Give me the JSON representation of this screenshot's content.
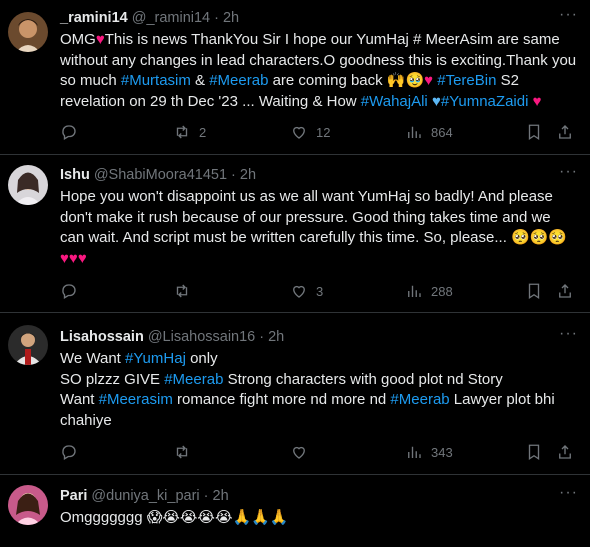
{
  "tweets": [
    {
      "name": "_ramini14",
      "handle": "@_ramini14",
      "time": "2h",
      "text_parts": [
        {
          "t": "OMG"
        },
        {
          "t": "♥",
          "c": "heart"
        },
        {
          "t": "This is news ThankYou Sir I hope our YumHaj # MeerAsim are same without any changes in lead characters.O goodness this is exciting.Thank you so much "
        },
        {
          "t": "#Murtasim",
          "c": "tag"
        },
        {
          "t": " & "
        },
        {
          "t": "#Meerab",
          "c": "tag"
        },
        {
          "t": " are coming back 🙌🥹"
        },
        {
          "t": "♥",
          "c": "heart"
        },
        {
          "t": " "
        },
        {
          "t": "#TereBin",
          "c": "tag"
        },
        {
          "t": " S2 revelation on 29 th Dec '23 ... Waiting & How "
        },
        {
          "t": "#WahajAli",
          "c": "tag"
        },
        {
          "t": " "
        },
        {
          "t": "♥",
          "c": "blueheart"
        },
        {
          "t": "#YumnaZaidi",
          "c": "tag"
        },
        {
          "t": " "
        },
        {
          "t": "♥",
          "c": "heart"
        }
      ],
      "replies": "",
      "retweets": "2",
      "likes": "12",
      "views": "864"
    },
    {
      "name": "Ishu",
      "handle": "@ShabiMoora41451",
      "time": "2h",
      "text_parts": [
        {
          "t": "Hope you won't disappoint us as we all want YumHaj so badly! And please don't make it rush because of our pressure. Good thing takes time and we can wait. And script must be written carefully this time. So, please... 🥺🥺🥺 "
        },
        {
          "t": "♥♥♥",
          "c": "heart"
        }
      ],
      "replies": "",
      "retweets": "",
      "likes": "3",
      "views": "288"
    },
    {
      "name": "Lisahossain",
      "handle": "@Lisahossain16",
      "time": "2h",
      "text_parts": [
        {
          "t": "We Want "
        },
        {
          "t": "#YumHaj",
          "c": "tag"
        },
        {
          "t": " only\nSO plzzz GIVE "
        },
        {
          "t": "#Meerab",
          "c": "tag"
        },
        {
          "t": " Strong characters with good plot nd Story\nWant "
        },
        {
          "t": "#Meerasim",
          "c": "tag"
        },
        {
          "t": " romance fight more nd more nd "
        },
        {
          "t": "#Meerab",
          "c": "tag"
        },
        {
          "t": " Lawyer plot bhi chahiye"
        }
      ],
      "replies": "",
      "retweets": "",
      "likes": "",
      "views": "343"
    },
    {
      "name": "Pari",
      "handle": "@duniya_ki_pari",
      "time": "2h",
      "text_parts": [
        {
          "t": "Omggggggg 😱😭😭😭😭🙏🙏🙏"
        }
      ],
      "replies": "",
      "retweets": "",
      "likes": "",
      "views": ""
    }
  ],
  "separator": "·",
  "more_glyph": "···",
  "icons": {
    "reply": "reply-icon",
    "retweet": "retweet-icon",
    "like": "heart-icon",
    "views": "views-icon",
    "bookmark": "bookmark-icon",
    "share": "share-icon"
  },
  "colors": {
    "background": "#000000",
    "text": "#e7e9ea",
    "muted": "#71767b",
    "link": "#1d9bf0",
    "heart": "#f91880",
    "divider": "#2f3336"
  }
}
